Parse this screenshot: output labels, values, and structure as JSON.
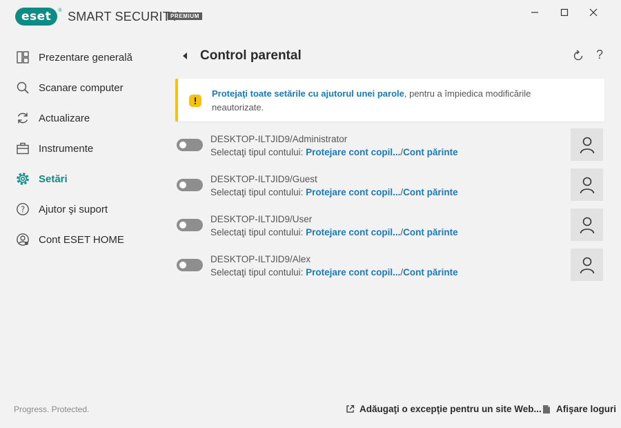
{
  "app": {
    "logo": "eset",
    "product_name": "SMART SECURITY",
    "edition": "PREMIUM",
    "window_controls": [
      "minimize-icon",
      "maximize-icon",
      "close-icon"
    ]
  },
  "sidebar": {
    "items": [
      {
        "label": "Prezentare generală",
        "icon": "overview-icon",
        "active": false
      },
      {
        "label": "Scanare computer",
        "icon": "search-icon",
        "active": false
      },
      {
        "label": "Actualizare",
        "icon": "refresh-icon",
        "active": false
      },
      {
        "label": "Instrumente",
        "icon": "briefcase-icon",
        "active": false
      },
      {
        "label": "Setări",
        "icon": "gear-icon",
        "active": true
      },
      {
        "label": "Ajutor şi suport",
        "icon": "help-icon",
        "active": false
      },
      {
        "label": "Cont ESET HOME",
        "icon": "user-circle-icon",
        "active": false
      }
    ],
    "footer": "Progress. Protected."
  },
  "main": {
    "title": "Control parental",
    "alert": {
      "link": "Protejaţi toate setările cu ajutorul unei parole",
      "text": ", pentru a împiedica modificările neautorizate."
    },
    "accounts": [
      {
        "name": "DESKTOP-ILTJID9/Administrator",
        "prefix": "Selectaţi tipul contului:",
        "child": "Protejare cont copil...",
        "sep": "/",
        "parent": "Cont părinte",
        "enabled": false
      },
      {
        "name": "DESKTOP-ILTJID9/Guest",
        "prefix": "Selectaţi tipul contului:",
        "child": "Protejare cont copil...",
        "sep": "/",
        "parent": "Cont părinte",
        "enabled": false
      },
      {
        "name": "DESKTOP-ILTJID9/User",
        "prefix": "Selectaţi tipul contului:",
        "child": "Protejare cont copil...",
        "sep": "/",
        "parent": "Cont părinte",
        "enabled": false
      },
      {
        "name": "DESKTOP-ILTJID9/Alex",
        "prefix": "Selectaţi tipul contului:",
        "child": "Protejare cont copil...",
        "sep": "/",
        "parent": "Cont părinte",
        "enabled": false
      }
    ],
    "footer_links": {
      "exception": "Adăugaţi o excepţie pentru un site Web...",
      "logs": "Afişare loguri"
    }
  },
  "colors": {
    "brand": "#0d8c86",
    "link": "#1a7ab8",
    "warning": "#f5c211"
  }
}
